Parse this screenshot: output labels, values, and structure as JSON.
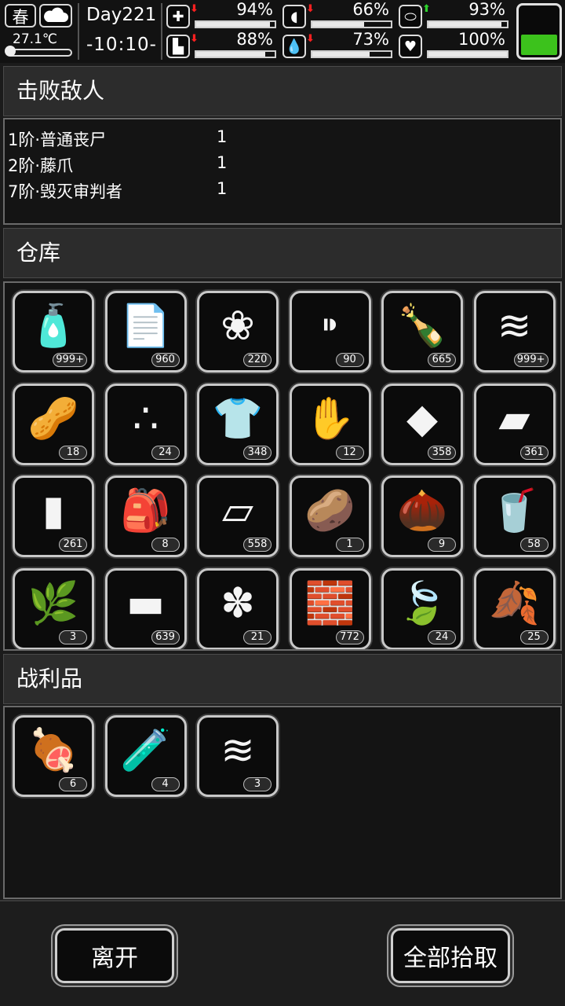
{
  "status": {
    "season": "春",
    "temperature": "27.1℃",
    "day": "Day221",
    "time": "-10:10-",
    "stats": [
      {
        "name": "health",
        "icon": "first-aid-icon",
        "trend": "down",
        "value": "94%",
        "level": 0.94
      },
      {
        "name": "hunger",
        "icon": "stomach-icon",
        "trend": "down",
        "value": "66%",
        "level": 0.66
      },
      {
        "name": "sanity",
        "icon": "pill-icon",
        "trend": "up",
        "value": "93%",
        "level": 0.93
      },
      {
        "name": "stamina",
        "icon": "boot-icon",
        "trend": "down",
        "value": "88%",
        "level": 0.88
      },
      {
        "name": "thirst",
        "icon": "water-drop-icon",
        "trend": "down",
        "value": "73%",
        "level": 0.73
      },
      {
        "name": "mood",
        "icon": "heart-icon",
        "trend": "none",
        "value": "100%",
        "level": 1.0
      }
    ],
    "battery_level": 0.35,
    "battery_color": "#3cc21c"
  },
  "enemies_section": {
    "title": "击败敌人",
    "rows": [
      {
        "name": "1阶·普通丧尸",
        "count": "1"
      },
      {
        "name": "2阶·藤爪",
        "count": "1"
      },
      {
        "name": "7阶·毁灭审判者",
        "count": "1"
      }
    ]
  },
  "warehouse_section": {
    "title": "仓库",
    "items": [
      {
        "icon": "glue-tube-icon",
        "glyph": "🧴",
        "count": "999+"
      },
      {
        "icon": "paper-scraps-icon",
        "glyph": "📄",
        "count": "960"
      },
      {
        "icon": "cotton-ball-icon",
        "glyph": "❀",
        "count": "220"
      },
      {
        "icon": "bullets-icon",
        "glyph": "⁍",
        "count": "90"
      },
      {
        "icon": "bottle-icon",
        "glyph": "🍾",
        "count": "665"
      },
      {
        "icon": "cloth-stack-icon",
        "glyph": "≋",
        "count": "999+"
      },
      {
        "icon": "seeds-icon",
        "glyph": "🥜",
        "count": "18"
      },
      {
        "icon": "beans-icon",
        "glyph": "∴",
        "count": "24"
      },
      {
        "icon": "torn-shirt-icon",
        "glyph": "👕",
        "count": "348"
      },
      {
        "icon": "ginseng-root-icon",
        "glyph": "✋",
        "count": "12"
      },
      {
        "icon": "crumpled-paper-icon",
        "glyph": "◆",
        "count": "358"
      },
      {
        "icon": "towel-icon",
        "glyph": "▰",
        "count": "361"
      },
      {
        "icon": "tape-roll-icon",
        "glyph": "▮",
        "count": "261"
      },
      {
        "icon": "sack-icon",
        "glyph": "🎒",
        "count": "8"
      },
      {
        "icon": "paper-sheets-icon",
        "glyph": "▱",
        "count": "558"
      },
      {
        "icon": "potato-icon",
        "glyph": "🥔",
        "count": "1"
      },
      {
        "icon": "chestnut-icon",
        "glyph": "🌰",
        "count": "9"
      },
      {
        "icon": "cola-cup-icon",
        "glyph": "🥤",
        "count": "58"
      },
      {
        "icon": "fern-leaf-icon",
        "glyph": "🌿",
        "count": "3"
      },
      {
        "icon": "blanket-icon",
        "glyph": "▬",
        "count": "639"
      },
      {
        "icon": "ginger-icon",
        "glyph": "✽",
        "count": "21"
      },
      {
        "icon": "bricks-icon",
        "glyph": "🧱",
        "count": "772"
      },
      {
        "icon": "green-herb-icon",
        "glyph": "🍃",
        "count": "24",
        "tint": "#3ecf1e"
      },
      {
        "icon": "yellow-herb-icon",
        "glyph": "🍂",
        "count": "25",
        "tint": "#e8c25a"
      }
    ]
  },
  "loot_section": {
    "title": "战利品",
    "items": [
      {
        "icon": "meat-chunk-icon",
        "glyph": "🍖",
        "count": "6"
      },
      {
        "icon": "test-tube-vii-icon",
        "glyph": "🧪",
        "count": "4"
      },
      {
        "icon": "cloth-stack-icon",
        "glyph": "≋",
        "count": "3"
      }
    ]
  },
  "buttons": {
    "leave": "离开",
    "pickup_all": "全部拾取"
  }
}
